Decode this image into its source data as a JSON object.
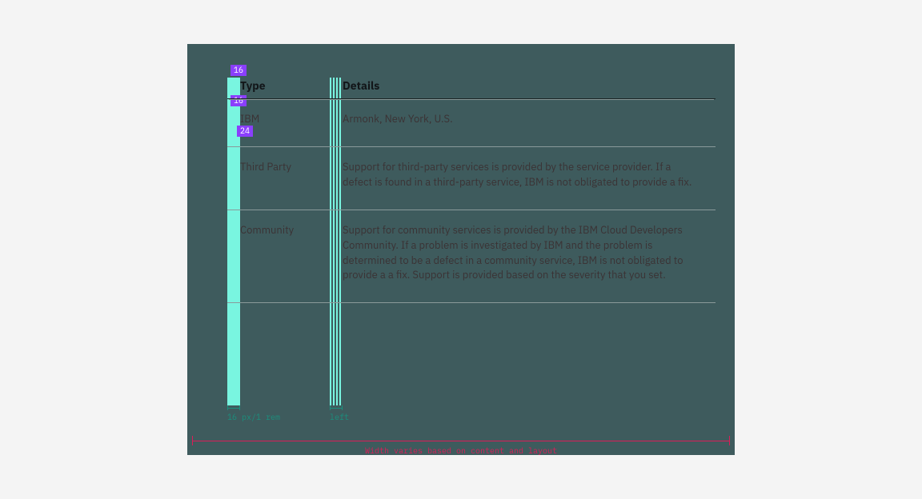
{
  "tags": {
    "t1": "16",
    "t2": "16",
    "t3": "24"
  },
  "table": {
    "headers": {
      "col1": "Type",
      "col2": "Details"
    },
    "rows": [
      {
        "type": "IBM",
        "details": "Armonk, New York, U.S."
      },
      {
        "type": "Third Party",
        "details": "Support for third-party services is provided by the service provider. If a defect is found in a third-party service, IBM is not obligated to provide a fix."
      },
      {
        "type": "Community",
        "details": "Support for community services is provided by the IBM Cloud Developers Community. If a problem is investigated by IBM and the problem is determined to be a defect in a community service, IBM is not obligated to provide a a fix. Support is provided based on the severity that you set."
      }
    ]
  },
  "spec": {
    "a": "16 px/1 rem",
    "b": "left"
  },
  "width_note": "Width varies based on content and layout"
}
